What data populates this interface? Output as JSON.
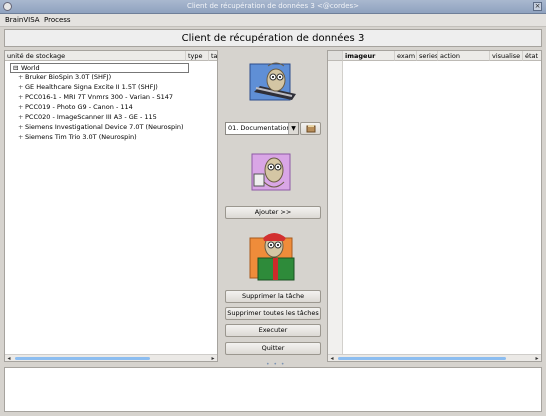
{
  "window": {
    "title": "Client de récupération de données 3 <@cordes>"
  },
  "menu": {
    "items": [
      "BrainVISA",
      "Process"
    ]
  },
  "header": {
    "title": "Client de récupération de données 3"
  },
  "left_panel": {
    "columns": [
      "unité de stockage",
      "type",
      "tai"
    ],
    "root": "World",
    "items": [
      "Bruker BioSpin 3.0T (SHFJ)",
      "GE Healthcare Signa Excite II 1.5T (SHFJ)",
      "PCC016-1 - MRI 7T Vnmrs 300 - Varian - S147",
      "PCC019 - Photo G9 - Canon - 114",
      "PCC020 - ImageScanner III A3 - GE - 115",
      "Siemens Investigational Device 7.0T (Neurospin)",
      "Siemens Tim Trio 3.0T (Neurospin)"
    ]
  },
  "center": {
    "combo_value": "01. Documentation",
    "add_button": "Ajouter >>",
    "remove_task": "Supprimer la tâche",
    "remove_all": "Supprimer toutes les tâches",
    "execute": "Executer",
    "quit": "Quitter"
  },
  "right_panel": {
    "columns": [
      "imageur",
      "exam",
      "series",
      "action",
      "visualise",
      "état"
    ]
  },
  "colors": {
    "scroll_thumb": "#8cbdf0",
    "title_bar": "#a9b8cf"
  }
}
